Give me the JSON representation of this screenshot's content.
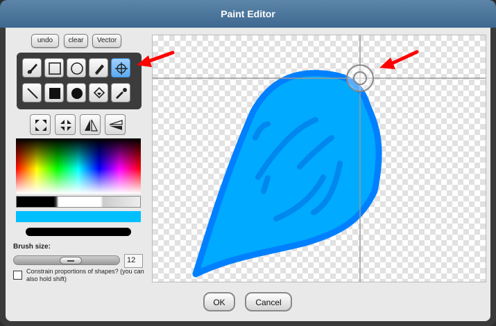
{
  "window": {
    "title": "Paint Editor"
  },
  "toolbar": {
    "undo": "undo",
    "clear": "clear",
    "vector": "Vector"
  },
  "tools": [
    {
      "name": "brush",
      "icon": "brush-icon",
      "active": false
    },
    {
      "name": "rectangle",
      "icon": "rectangle-icon",
      "active": false
    },
    {
      "name": "ellipse",
      "icon": "ellipse-icon",
      "active": false
    },
    {
      "name": "eraser",
      "icon": "eraser-icon",
      "active": false
    },
    {
      "name": "rotation-center",
      "icon": "crosshair-icon",
      "active": true
    },
    {
      "name": "line",
      "icon": "line-icon",
      "active": false
    },
    {
      "name": "filled-rectangle",
      "icon": "filled-rectangle-icon",
      "active": false
    },
    {
      "name": "filled-ellipse",
      "icon": "filled-ellipse-icon",
      "active": false
    },
    {
      "name": "paint-bucket",
      "icon": "paint-bucket-icon",
      "active": false
    },
    {
      "name": "eyedropper",
      "icon": "eyedropper-icon",
      "active": false
    }
  ],
  "transforms": [
    {
      "name": "grow",
      "icon": "expand-icon"
    },
    {
      "name": "shrink",
      "icon": "shrink-icon"
    },
    {
      "name": "flip-horizontal",
      "icon": "flip-horizontal-icon"
    },
    {
      "name": "flip-vertical",
      "icon": "flip-vertical-icon"
    }
  ],
  "colors": {
    "current": "#00bfff",
    "shape_fill": "#00aaff",
    "shape_stroke": "#0080ff",
    "annotation": "#ff0000"
  },
  "brush": {
    "label": "Brush size:",
    "size": "12"
  },
  "constrain": {
    "label": "Constrain proportions of shapes? (you can also hold shift)",
    "checked": false
  },
  "buttons": {
    "ok": "OK",
    "cancel": "Cancel"
  }
}
